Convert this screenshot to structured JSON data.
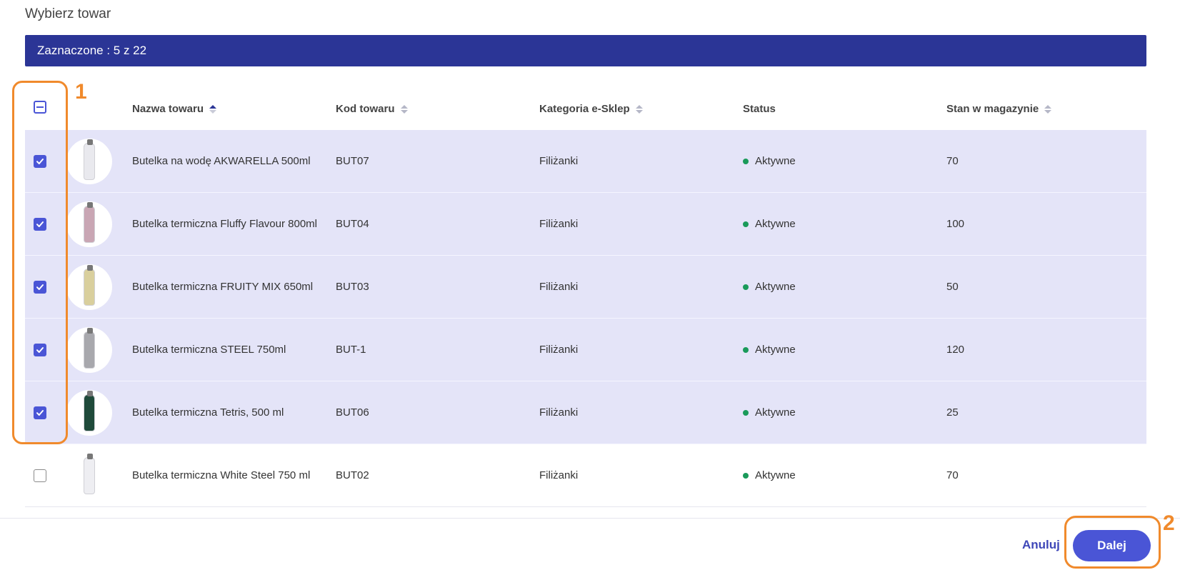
{
  "dialog": {
    "title": "Wybierz towar"
  },
  "banner": {
    "text": "Zaznaczone : 5 z 22"
  },
  "table": {
    "headers": {
      "name": "Nazwa towaru",
      "code": "Kod towaru",
      "category": "Kategoria e-Sklep",
      "status": "Status",
      "stock": "Stan w magazynie"
    },
    "rows": [
      {
        "name": "Butelka na wodę AKWARELLA 500ml",
        "code": "BUT07",
        "category": "Filiżanki",
        "status": "Aktywne",
        "stock": "70",
        "checked": true,
        "thumb_color": "#e9e9ee"
      },
      {
        "name": "Butelka termiczna Fluffy Flavour 800ml",
        "code": "BUT04",
        "category": "Filiżanki",
        "status": "Aktywne",
        "stock": "100",
        "checked": true,
        "thumb_color": "#c9a6b4"
      },
      {
        "name": "Butelka termiczna FRUITY MIX 650ml",
        "code": "BUT03",
        "category": "Filiżanki",
        "status": "Aktywne",
        "stock": "50",
        "checked": true,
        "thumb_color": "#d9cf9d"
      },
      {
        "name": "Butelka termiczna STEEL 750ml",
        "code": "BUT-1",
        "category": "Filiżanki",
        "status": "Aktywne",
        "stock": "120",
        "checked": true,
        "thumb_color": "#a8a8ad"
      },
      {
        "name": "Butelka termiczna Tetris, 500 ml",
        "code": "BUT06",
        "category": "Filiżanki",
        "status": "Aktywne",
        "stock": "25",
        "checked": true,
        "thumb_color": "#1f4a3a"
      },
      {
        "name": "Butelka termiczna White Steel 750 ml",
        "code": "BUT02",
        "category": "Filiżanki",
        "status": "Aktywne",
        "stock": "70",
        "checked": false,
        "thumb_color": "#eeeef2"
      }
    ]
  },
  "footer": {
    "cancel_label": "Anuluj",
    "next_label": "Dalej"
  },
  "annotations": {
    "label_1": "1",
    "label_2": "2"
  },
  "colors": {
    "banner": "#2b3596",
    "accent": "#4a55d6",
    "selected_row": "#e4e4f8",
    "status_active": "#1a9a5a",
    "highlight": "#f08a2c"
  }
}
